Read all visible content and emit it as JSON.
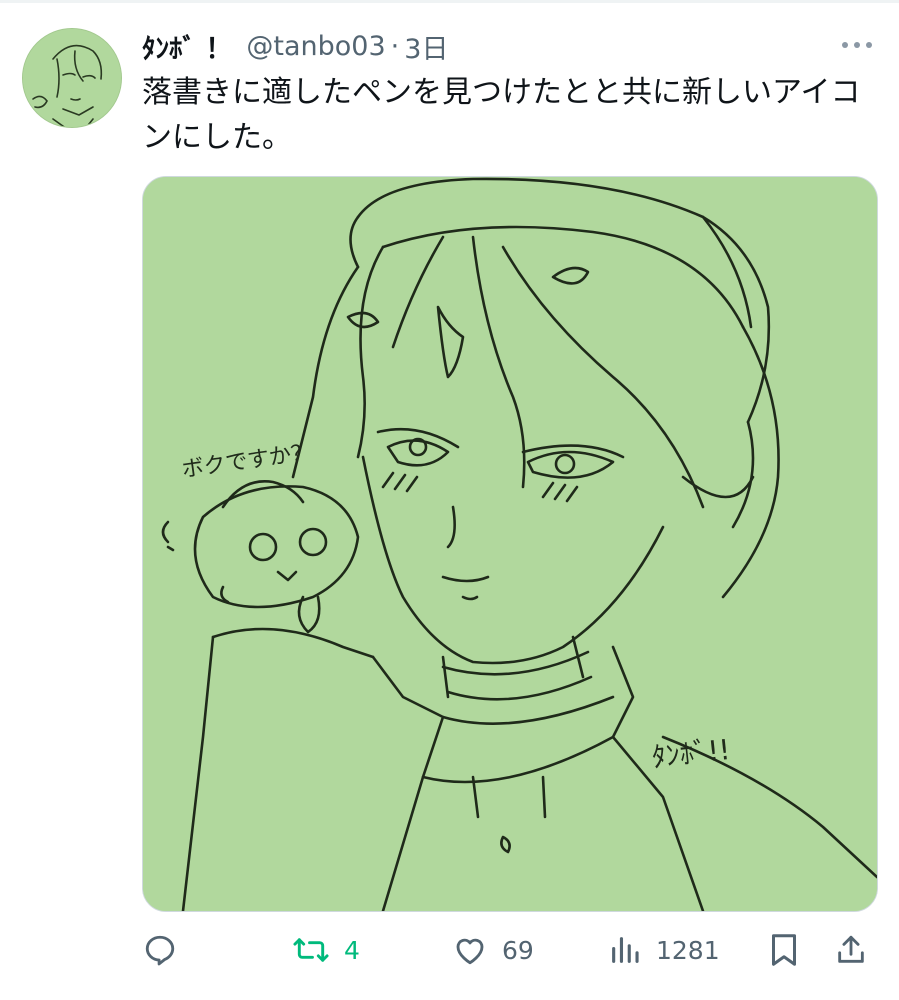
{
  "tweet": {
    "display_name": "ﾀﾝﾎﾞ ！",
    "handle": "@tanbo03",
    "separator": "·",
    "time": "3日",
    "text": "落書きに適したペンを見つけたとと共に新しいアイコンにした。",
    "media": {
      "background_color": "#b1d89d",
      "drawn_texts": [
        "ボクですか？",
        "ﾀﾝﾎﾞ!!"
      ]
    }
  },
  "actions": {
    "reply": {
      "icon": "reply-icon",
      "count": ""
    },
    "retweet": {
      "icon": "retweet-icon",
      "count": "4",
      "color": "#00ba7c"
    },
    "like": {
      "icon": "heart-icon",
      "count": "69"
    },
    "views": {
      "icon": "views-icon",
      "count": "1281"
    },
    "bookmark": {
      "icon": "bookmark-icon"
    },
    "share": {
      "icon": "share-icon"
    }
  },
  "colors": {
    "text_primary": "#0f1419",
    "text_secondary": "#536471",
    "retweet_active": "#00ba7c",
    "media_bg": "#b1d89d"
  }
}
